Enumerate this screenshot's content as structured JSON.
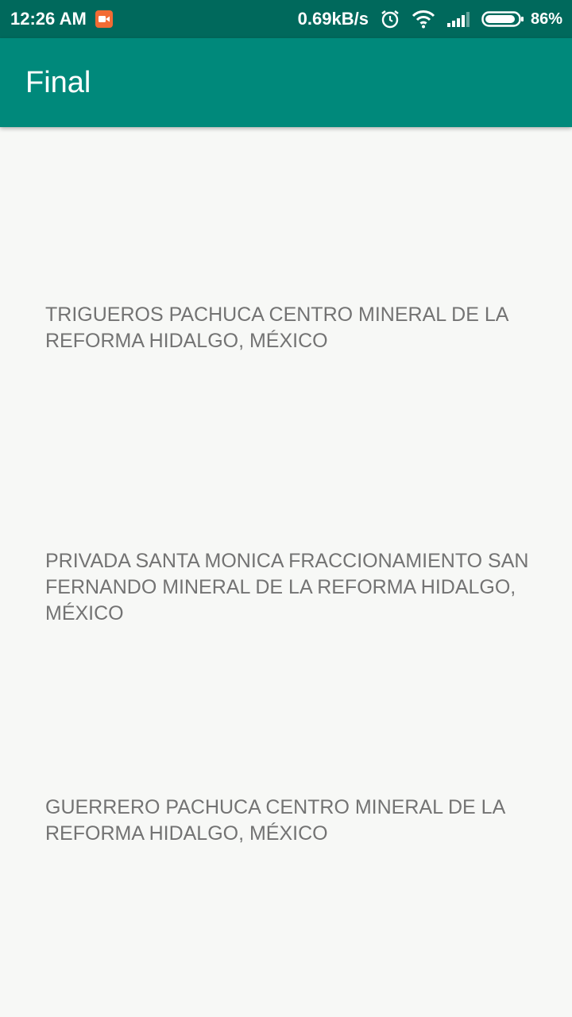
{
  "status_bar": {
    "time": "12:26 AM",
    "net_speed": "0.69kB/s",
    "battery": "86%",
    "icons": [
      "screen-record-icon",
      "alarm-icon",
      "wifi-icon",
      "signal-icon",
      "battery-icon"
    ],
    "battery_level": 0.86
  },
  "app_bar": {
    "title": "Final"
  },
  "addresses": [
    "TRIGUEROS PACHUCA CENTRO MINERAL DE LA REFORMA HIDALGO, MÉXICO",
    "PRIVADA SANTA MONICA FRACCIONAMIENTO SAN FERNANDO MINERAL DE LA REFORMA HIDALGO, MÉXICO",
    "GUERRERO PACHUCA CENTRO MINERAL DE LA REFORMA HIDALGO, MÉXICO"
  ],
  "colors": {
    "status_bar": "#00695c",
    "app_bar": "#00897b",
    "background": "#f7f8f6",
    "text": "#737373",
    "record_badge": "#f26b34"
  }
}
